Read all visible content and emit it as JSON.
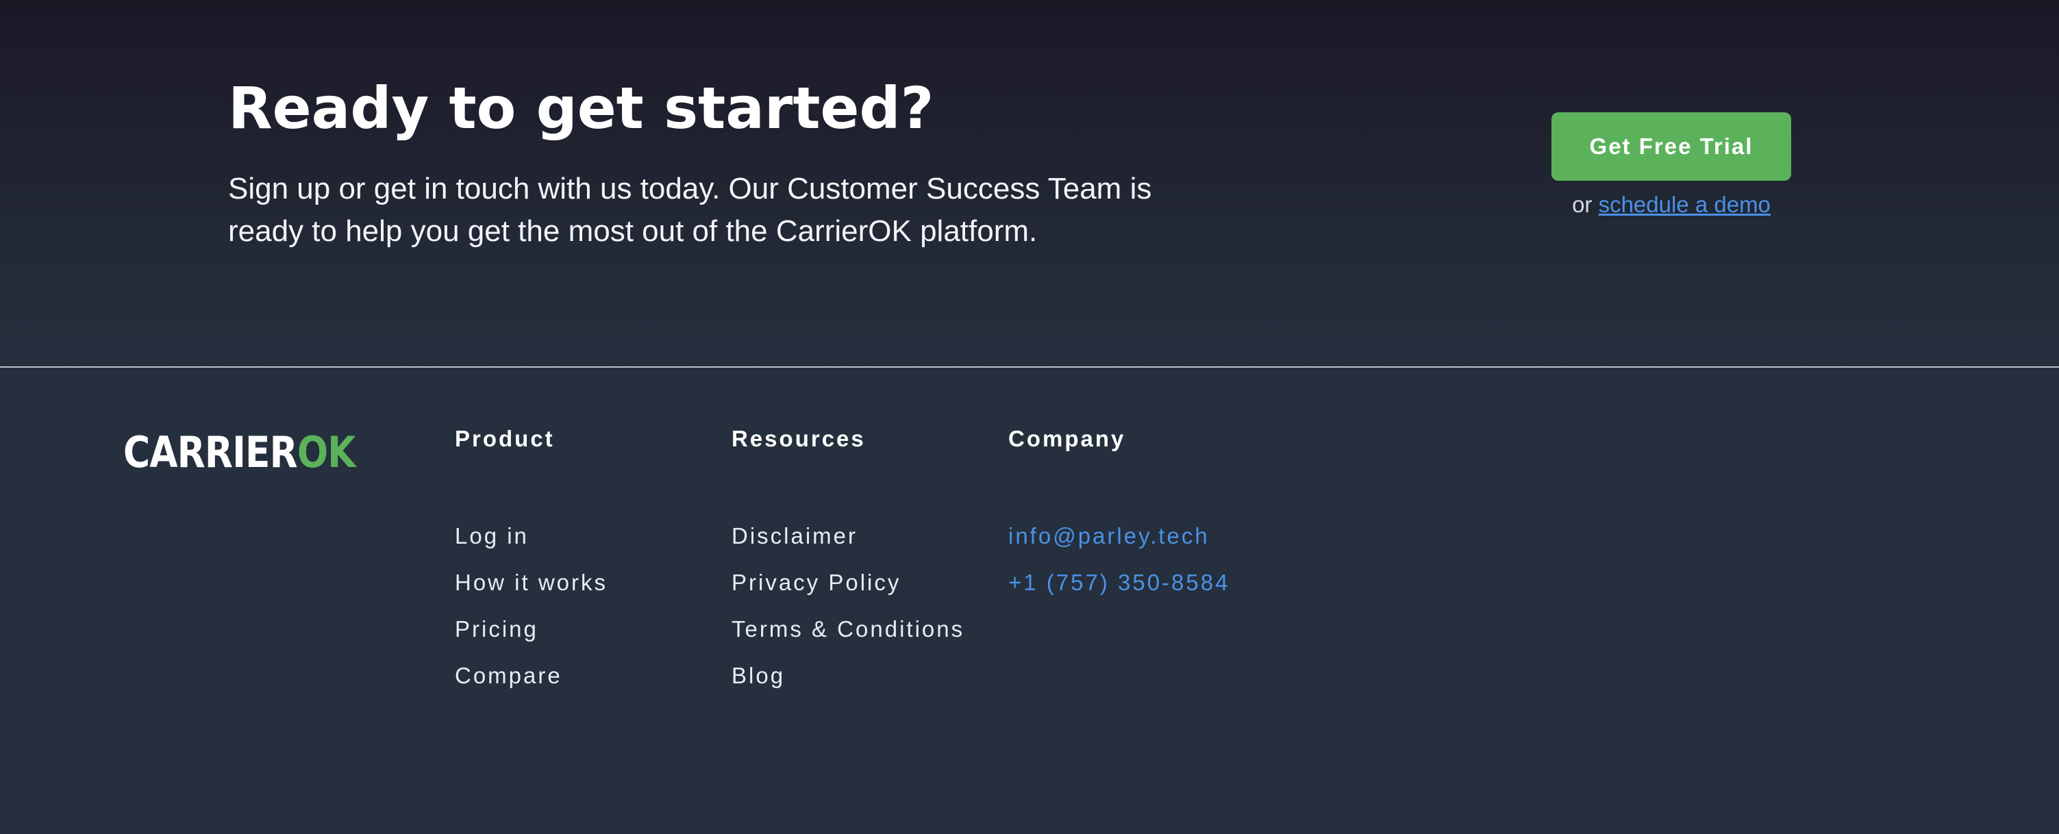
{
  "cta": {
    "title": "Ready to get started?",
    "text": "Sign up or get in touch with us today. Our Customer Success Team is ready to help you get the most out of the CarrierOK platform.",
    "trial_button": "Get Free Trial",
    "demo_prefix": "or",
    "demo_link": "schedule a demo"
  },
  "footer": {
    "logo": {
      "main": "CARRIER",
      "accent": "OK"
    },
    "columns": [
      {
        "heading": "Product",
        "links": [
          "Log in",
          "How it works",
          "Pricing",
          "Compare"
        ]
      },
      {
        "heading": "Resources",
        "links": [
          "Disclaimer",
          "Privacy Policy",
          "Terms & Conditions",
          "Blog"
        ]
      },
      {
        "heading": "Company",
        "links": [
          "info@parley.tech",
          "+1 (757) 350-8584"
        ]
      }
    ]
  },
  "colors": {
    "background": "#252f3d",
    "accent_green": "#5cb25b",
    "link_blue": "#4a92e6"
  }
}
